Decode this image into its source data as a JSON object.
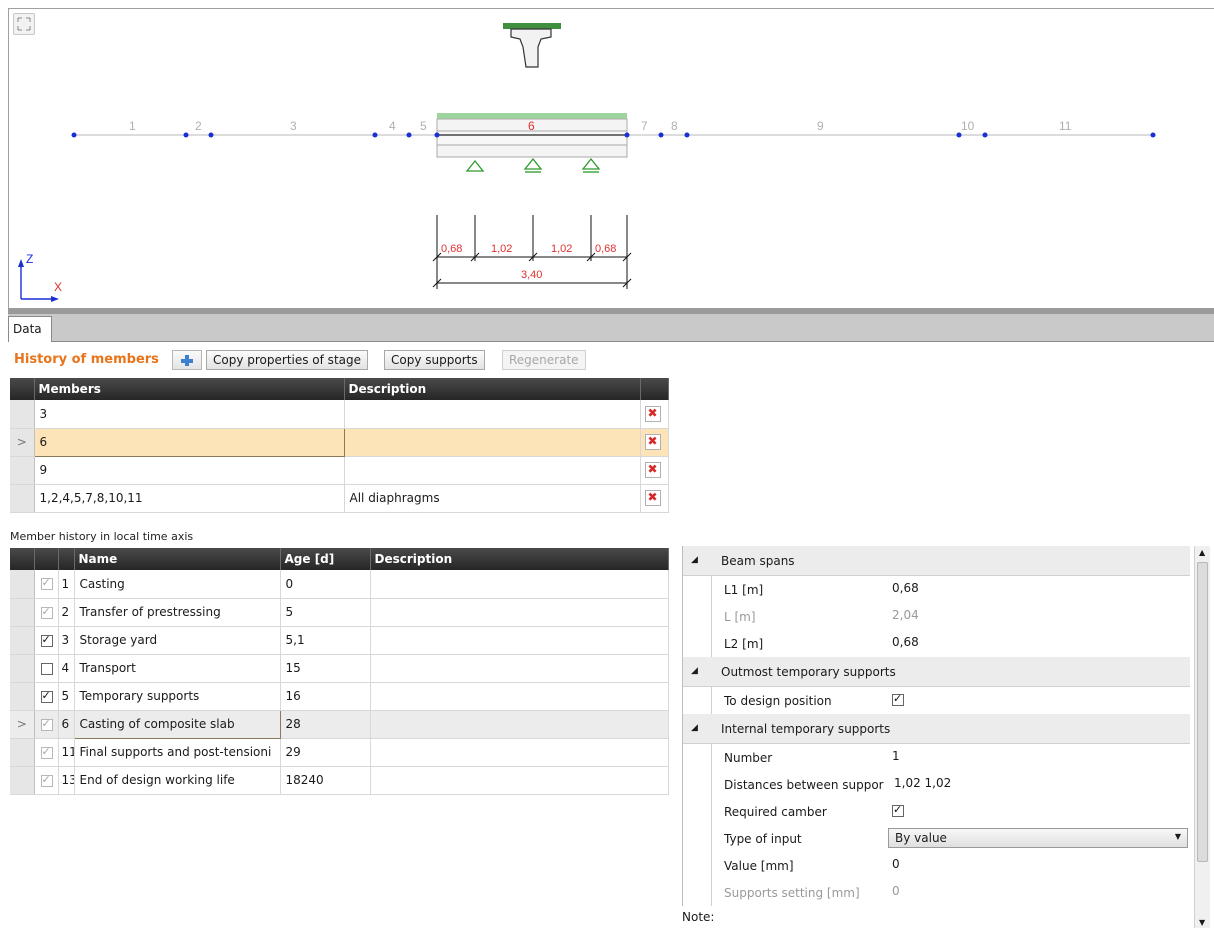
{
  "tabs": [
    {
      "label": "Data"
    }
  ],
  "toolbar": {
    "title": "History of members",
    "copy_stage_label": "Copy properties of stage",
    "copy_supports_label": "Copy supports",
    "regenerate_label": "Regenerate"
  },
  "members_table": {
    "columns": [
      "Members",
      "Description"
    ],
    "rows": [
      {
        "members": "3",
        "description": ""
      },
      {
        "members": "6",
        "description": ""
      },
      {
        "members": "9",
        "description": ""
      },
      {
        "members": "1,2,4,5,7,8,10,11",
        "description": "All diaphragms"
      }
    ]
  },
  "history_label": "Member history in local time axis",
  "history_table": {
    "columns": [
      "Name",
      "Age [d]",
      "Description"
    ],
    "rows": [
      {
        "no": "1",
        "name": "Casting",
        "age": "0",
        "description": "",
        "checked": true,
        "enabled": false
      },
      {
        "no": "2",
        "name": "Transfer of prestressing",
        "age": "5",
        "description": "",
        "checked": true,
        "enabled": false
      },
      {
        "no": "3",
        "name": "Storage yard",
        "age": "5,1",
        "description": "",
        "checked": true,
        "enabled": true
      },
      {
        "no": "4",
        "name": "Transport",
        "age": "15",
        "description": "",
        "checked": false,
        "enabled": true
      },
      {
        "no": "5",
        "name": "Temporary supports",
        "age": "16",
        "description": "",
        "checked": true,
        "enabled": true
      },
      {
        "no": "6",
        "name": "Casting of composite slab",
        "age": "28",
        "description": "",
        "checked": true,
        "enabled": false
      },
      {
        "no": "11",
        "name": "Final supports and post-tensioni",
        "age": "29",
        "description": "",
        "checked": true,
        "enabled": false
      },
      {
        "no": "13",
        "name": "End of design working life",
        "age": "18240",
        "description": "",
        "checked": true,
        "enabled": false
      }
    ]
  },
  "properties": {
    "beam_spans": {
      "title": "Beam spans",
      "l1_label": "L1 [m]",
      "l1_value": "0,68",
      "l_label": "L [m]",
      "l_value": "2,04",
      "l2_label": "L2 [m]",
      "l2_value": "0,68"
    },
    "outmost": {
      "title": "Outmost temporary supports",
      "design_pos_label": "To design position",
      "design_pos_checked": true
    },
    "internal": {
      "title": "Internal temporary supports",
      "number_label": "Number",
      "number_value": "1",
      "distances_label": "Distances between suppor",
      "distances_value": "1,02  1,02",
      "camber_label": "Required camber",
      "camber_checked": true,
      "input_type_label": "Type of input",
      "input_type_value": "By value",
      "value_label": "Value [mm]",
      "value_value": "0",
      "setting_label": "Supports setting [mm]",
      "setting_value": "0"
    }
  },
  "note_label": "Note:",
  "drawing": {
    "member_numbers": [
      "1",
      "2",
      "3",
      "4",
      "5",
      "6",
      "7",
      "8",
      "9",
      "10",
      "11"
    ],
    "dimensions": [
      "0,68",
      "1,02",
      "1,02",
      "0,68",
      "3,40"
    ],
    "axis_z": "Z",
    "axis_x": "X",
    "colors": {
      "members": "#b0b0b0",
      "nodes": "#1a2fd6",
      "selected": "#e03030",
      "supports": "#2a9a2a",
      "slab": "#9ed49e"
    }
  }
}
